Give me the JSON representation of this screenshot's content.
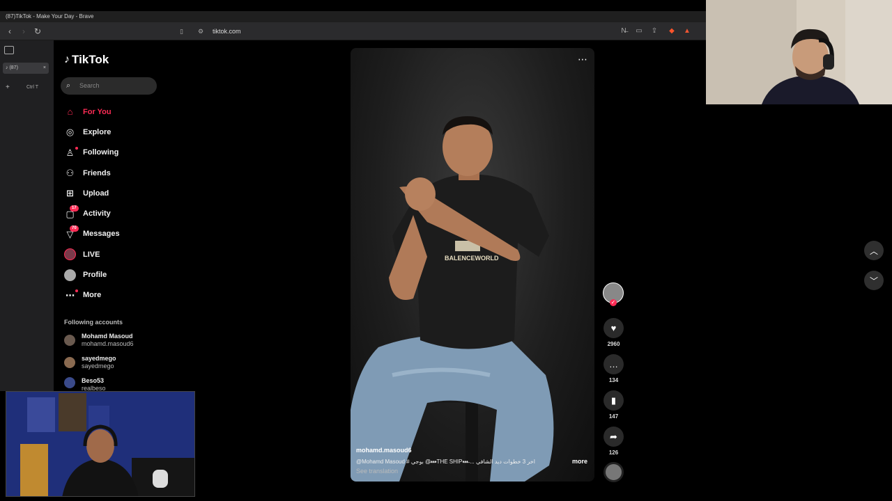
{
  "browser": {
    "window_title": "(87)TikTok - Make Your Day - Brave",
    "url": "tiktok.com",
    "tab_label": "(87)",
    "new_tab_shortcut": "Ctrl T"
  },
  "tiktok": {
    "logo": "TikTok",
    "search_placeholder": "Search",
    "menu": [
      {
        "label": "For You",
        "icon": "home-icon",
        "active": true
      },
      {
        "label": "Explore",
        "icon": "compass-icon"
      },
      {
        "label": "Following",
        "icon": "user-follow-icon"
      },
      {
        "label": "Friends",
        "icon": "friends-icon"
      },
      {
        "label": "Upload",
        "icon": "plus-square-icon"
      },
      {
        "label": "Activity",
        "icon": "inbox-icon",
        "badge": "17"
      },
      {
        "label": "Messages",
        "icon": "send-icon",
        "badge": "70"
      },
      {
        "label": "LIVE",
        "icon": "live-icon"
      },
      {
        "label": "Profile",
        "icon": "avatar-icon"
      },
      {
        "label": "More",
        "icon": "more-dots-icon"
      }
    ],
    "following_title": "Following accounts",
    "accounts": [
      {
        "name": "Mohamd Masoud",
        "handle": "mohamd.masoud6"
      },
      {
        "name": "sayedmego",
        "handle": "sayedmego"
      },
      {
        "name": "Beso53",
        "handle": "realbeso"
      }
    ]
  },
  "video": {
    "author": "mohamd.masoud6",
    "caption": "@Mohamd Masoud # بوجي @•̶•̶•̶THE SHIP•̶•̶•̶ ... اخر 3 خطوات ديد الشافي",
    "more_label": "more",
    "see_translation": "See translation",
    "shirt_text": "BALENCEWORLD",
    "likes": "2960",
    "comments": "134",
    "saves": "147",
    "shares": "126"
  },
  "colors": {
    "accent": "#fe2c55",
    "background": "#000000"
  }
}
